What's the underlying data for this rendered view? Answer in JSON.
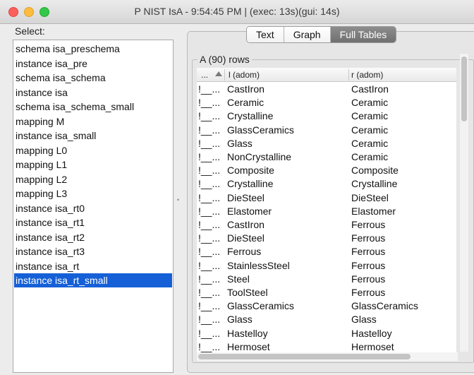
{
  "window": {
    "title": "P NIST IsA - 9:54:45 PM | (exec: 13s)(gui: 14s)"
  },
  "sidebar": {
    "label": "Select:",
    "items": [
      "schema isa_preschema",
      "instance isa_pre",
      "schema isa_schema",
      "instance isa",
      "schema isa_schema_small",
      "mapping M",
      "instance isa_small",
      "mapping L0",
      "mapping L1",
      "mapping L2",
      "mapping L3",
      "instance isa_rt0",
      "instance isa_rt1",
      "instance isa_rt2",
      "instance isa_rt3",
      "instance isa_rt",
      "instance isa_rt_small"
    ],
    "selected_index": 16
  },
  "tabs": [
    "Text",
    "Graph",
    "Full Tables"
  ],
  "active_tab": 2,
  "table": {
    "title": "A (90) rows",
    "columns": [
      "...",
      "l (adom)",
      "r (adom)"
    ],
    "rows": [
      [
        "!__...",
        "CastIron",
        "CastIron"
      ],
      [
        "!__...",
        "Ceramic",
        "Ceramic"
      ],
      [
        "!__...",
        "Crystalline",
        "Ceramic"
      ],
      [
        "!__...",
        "GlassCeramics",
        "Ceramic"
      ],
      [
        "!__...",
        "Glass",
        "Ceramic"
      ],
      [
        "!__...",
        "NonCrystalline",
        "Ceramic"
      ],
      [
        "!__...",
        "Composite",
        "Composite"
      ],
      [
        "!__...",
        "Crystalline",
        "Crystalline"
      ],
      [
        "!__...",
        "DieSteel",
        "DieSteel"
      ],
      [
        "!__...",
        "Elastomer",
        "Elastomer"
      ],
      [
        "!__...",
        "CastIron",
        "Ferrous"
      ],
      [
        "!__...",
        "DieSteel",
        "Ferrous"
      ],
      [
        "!__...",
        "Ferrous",
        "Ferrous"
      ],
      [
        "!__...",
        "StainlessSteel",
        "Ferrous"
      ],
      [
        "!__...",
        "Steel",
        "Ferrous"
      ],
      [
        "!__...",
        "ToolSteel",
        "Ferrous"
      ],
      [
        "!__...",
        "GlassCeramics",
        "GlassCeramics"
      ],
      [
        "!__...",
        "Glass",
        "Glass"
      ],
      [
        "!__...",
        "Hastelloy",
        "Hastelloy"
      ],
      [
        "!__...",
        "Hermoset",
        "Hermoset"
      ]
    ]
  }
}
